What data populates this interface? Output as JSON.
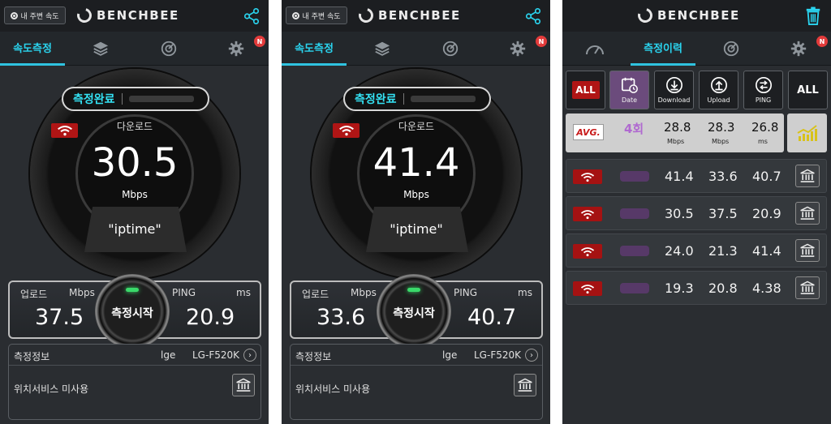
{
  "common": {
    "app_name": "BENCHBEE",
    "nearby_label": "내 주변 속도",
    "tab_speed": "속도측정",
    "badge": "N"
  },
  "screens": [
    {
      "status": "측정완료",
      "download_label": "다운로드",
      "download_value": "30.5",
      "download_unit": "Mbps",
      "server": "\"iptime\"",
      "upload_label": "업로드",
      "upload_unit": "Mbps",
      "upload_value": "37.5",
      "ping_label": "PING",
      "ping_unit": "ms",
      "ping_value": "20.9",
      "start_label": "측정시작",
      "info_title": "측정정보",
      "carrier": "lge",
      "device": "LG-F520K",
      "location": "위치서비스 미사용"
    },
    {
      "status": "측정완료",
      "download_label": "다운로드",
      "download_value": "41.4",
      "download_unit": "Mbps",
      "server": "\"iptime\"",
      "upload_label": "업로드",
      "upload_unit": "Mbps",
      "upload_value": "33.6",
      "ping_label": "PING",
      "ping_unit": "ms",
      "ping_value": "40.7",
      "start_label": "측정시작",
      "info_title": "측정정보",
      "carrier": "lge",
      "device": "LG-F520K",
      "location": "위치서비스 미사용"
    }
  ],
  "history": {
    "tab_label": "측정이력",
    "filters": [
      {
        "label": "ALL",
        "icon": "all-red"
      },
      {
        "label": "Date",
        "icon": "calendar-icon"
      },
      {
        "label": "Download",
        "icon": "download-icon"
      },
      {
        "label": "Upload",
        "icon": "upload-icon"
      },
      {
        "label": "PING",
        "icon": "ping-icon"
      },
      {
        "label": "ALL",
        "icon": "all-white"
      }
    ],
    "avg": {
      "label": "AVG.",
      "count": "4회",
      "download": "28.8",
      "download_unit": "Mbps",
      "upload": "28.3",
      "upload_unit": "Mbps",
      "ping": "26.8",
      "ping_unit": "ms"
    },
    "rows": [
      {
        "download": "41.4",
        "upload": "33.6",
        "ping": "40.7"
      },
      {
        "download": "30.5",
        "upload": "37.5",
        "ping": "20.9"
      },
      {
        "download": "24.0",
        "upload": "21.3",
        "ping": "41.4"
      },
      {
        "download": "19.3",
        "upload": "20.8",
        "ping": "4.38"
      }
    ]
  },
  "colors": {
    "accent": "#2ad4ef",
    "badge": "#e23b3b",
    "wifi_badge": "#b01515",
    "background": "#2a2d31"
  }
}
